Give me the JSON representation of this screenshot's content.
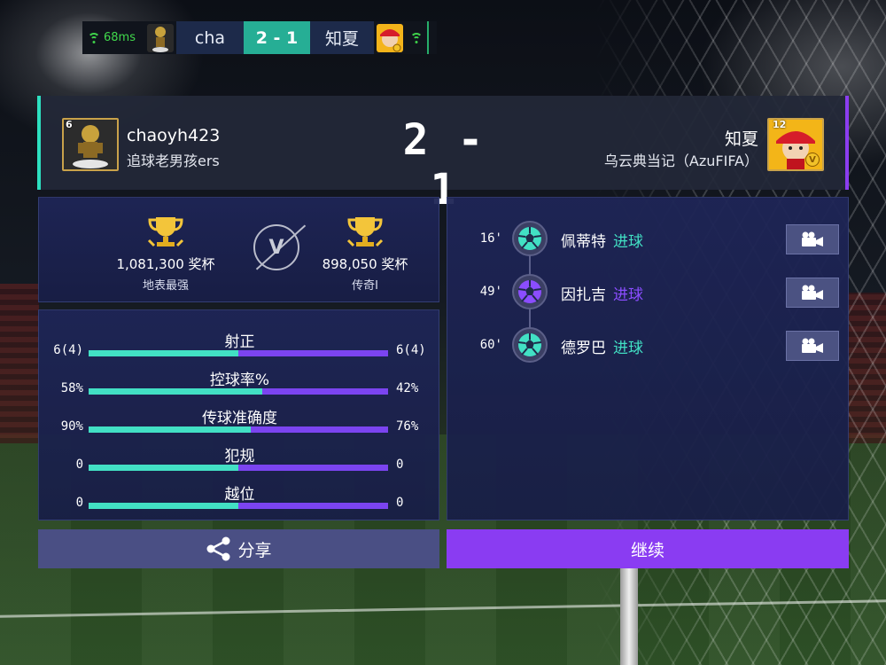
{
  "hud": {
    "ping": "68ms",
    "home_name": "cha",
    "score": "2 - 1",
    "away_name": "知夏"
  },
  "scoreboard": {
    "home": {
      "level": "6",
      "name": "chaoyh423",
      "club": "追球老男孩ers"
    },
    "away": {
      "level": "12",
      "name": "知夏",
      "club": "乌云典当记（AzuFIFA）",
      "vip": "V"
    },
    "score": "2 - 1"
  },
  "trophies": {
    "home": {
      "count": "1,081,300 奖杯",
      "rank": "地表最强"
    },
    "versus": "V",
    "away": {
      "count": "898,050 奖杯",
      "rank": "传奇I"
    }
  },
  "stats": [
    {
      "label": "射正",
      "home": "6(4)",
      "away": "6(4)",
      "home_share": 0.5
    },
    {
      "label": "控球率%",
      "home": "58%",
      "away": "42%",
      "home_share": 0.58
    },
    {
      "label": "传球准确度",
      "home": "90%",
      "away": "76%",
      "home_share": 0.54
    },
    {
      "label": "犯规",
      "home": "0",
      "away": "0",
      "home_share": 0.5
    },
    {
      "label": "越位",
      "home": "0",
      "away": "0",
      "home_share": 0.5
    }
  ],
  "events": [
    {
      "minute": "16'",
      "player": "佩蒂特",
      "type": "进球",
      "team": "home",
      "team_color": "#42e0c4"
    },
    {
      "minute": "49'",
      "player": "因扎吉",
      "type": "进球",
      "team": "away",
      "team_color": "#8b4dff"
    },
    {
      "minute": "60'",
      "player": "德罗巴",
      "type": "进球",
      "team": "home",
      "team_color": "#42e0c4"
    }
  ],
  "buttons": {
    "share": "分享",
    "continue": "继续"
  },
  "colors": {
    "home_accent": "#42e0c4",
    "away_accent": "#8b4dff",
    "continue_bg": "#8a3cf2",
    "share_bg": "#4a4f84"
  },
  "icons": {
    "ping": "wifi-icon",
    "trophy": "trophy-icon",
    "goal": "soccer-ball-icon",
    "video": "video-camera-icon",
    "share": "share-icon"
  }
}
